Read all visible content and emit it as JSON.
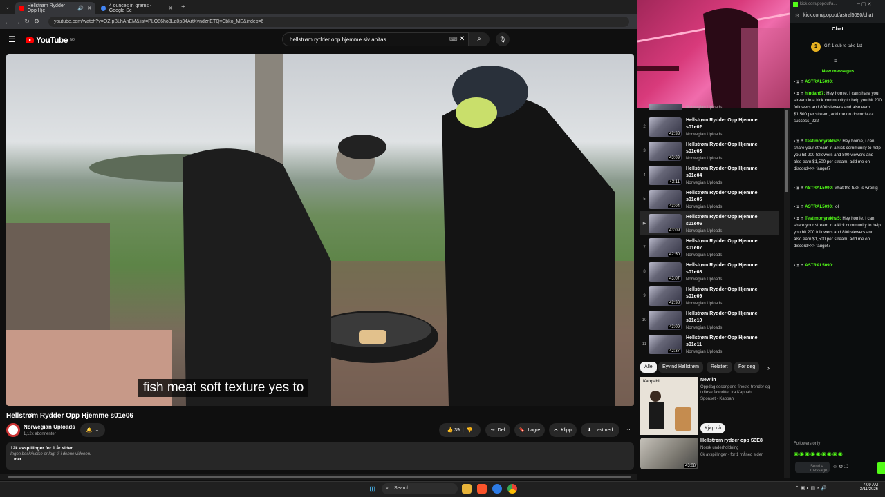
{
  "browser_tabs": [
    {
      "label": "Hellstrøm Rydder Opp Hje",
      "active": true
    },
    {
      "label": "4 ounces in grams - Google Se",
      "active": false
    }
  ],
  "url": "youtube.com/watch?v=OZIpBLhAnEM&list=PLO86ho8La0p34ArtXvndznETQvCbko_ME&index=6",
  "youtube": {
    "logo_text": "YouTube",
    "logo_region": "NO",
    "search_value": "hellstrøm rydder opp hjemme siv anitas"
  },
  "video": {
    "caption": "fish meat soft texture yes to",
    "title": "Hellstrøm Rydder Opp Hjemme s01e06",
    "channel": "Norwegian Uploads",
    "subscribers": "1,12k abonnenter"
  },
  "actions": {
    "likes": "39",
    "share": "Del",
    "save": "Lagre",
    "clip": "Klipp",
    "download": "Last ned"
  },
  "description": {
    "stats": "12k avspillinger  for 1 år siden",
    "text": "Ingen beskrivelse er lagt til i denne videoen.",
    "more": "...mer"
  },
  "playlist": [
    {
      "num": "",
      "title": "",
      "channel": "Norwegian Uploads",
      "duration": "",
      "current": false,
      "partial": true
    },
    {
      "num": "2",
      "title": "Hellstrøm Rydder Opp Hjemme s01e02",
      "channel": "Norwegian Uploads",
      "duration": "42:33",
      "current": false
    },
    {
      "num": "3",
      "title": "Hellstrøm Rydder Opp Hjemme s01e03",
      "channel": "Norwegian Uploads",
      "duration": "43:09",
      "current": false
    },
    {
      "num": "4",
      "title": "Hellstrøm Rydder Opp Hjemme s01e04",
      "channel": "Norwegian Uploads",
      "duration": "43:11",
      "current": false
    },
    {
      "num": "5",
      "title": "Hellstrøm Rydder Opp Hjemme s01e05",
      "channel": "Norwegian Uploads",
      "duration": "43:04",
      "current": false
    },
    {
      "num": "▶",
      "title": "Hellstrøm Rydder Opp Hjemme s01e06",
      "channel": "Norwegian Uploads",
      "duration": "43:09",
      "current": true
    },
    {
      "num": "7",
      "title": "Hellstrøm Rydder Opp Hjemme s01e07",
      "channel": "Norwegian Uploads",
      "duration": "42:50",
      "current": false
    },
    {
      "num": "8",
      "title": "Hellstrøm Rydder Opp Hjemme s01e08",
      "channel": "Norwegian Uploads",
      "duration": "43:07",
      "current": false
    },
    {
      "num": "9",
      "title": "Hellstrøm Rydder Opp Hjemme s01e09",
      "channel": "Norwegian Uploads",
      "duration": "42:38",
      "current": false
    },
    {
      "num": "10",
      "title": "Hellstrøm Rydder Opp Hjemme s01e10",
      "channel": "Norwegian Uploads",
      "duration": "43:09",
      "current": false
    },
    {
      "num": "11",
      "title": "Hellstrøm Rydder Opp Hjemme s01e11",
      "channel": "Norwegian Uploads",
      "duration": "42:37",
      "current": false
    }
  ],
  "chips": [
    "Alle",
    "Eyvind Hellstrøm",
    "Relatert",
    "For deg"
  ],
  "ad": {
    "title": "New in",
    "text": "Oppdag sesongens fineste trender og tidløse favoritter fra Kappahl.",
    "sponsor": "Sponset · Kappahl",
    "cta": "Kjøp nå",
    "brand": "Kappahl"
  },
  "rec": {
    "title": "Hellstrøm rydder opp S3E8",
    "channel": "Norsk underholdning",
    "stats": "6k avspillinger · for 1 måned siden",
    "duration": "43:08"
  },
  "kick": {
    "url_small": "kick.com/popout/a...",
    "url": "kick.com/popout/astral5090/chat",
    "header": "Chat",
    "gift": "Gift 1 sub to take 1st",
    "new_messages": "New messages",
    "followers_only": "Followers only",
    "placeholder": "Send a message"
  },
  "chat": [
    {
      "user": "ASTRAL5090:",
      "text": "",
      "color": "#53fc18"
    },
    {
      "user": "hindan67:",
      "text": "Hey homie, I can share your stream in a kick community to help you hit 200 followers and 800 viewers and also earn $1,500 per stream, add me on discord>>> success_222",
      "color": "#53fc18"
    },
    {
      "user": "Testimonyrekha5:",
      "text": "Hey homie, i can share your stream in a kick community to help you hit 200 followers and 800 viewers and also earn $1,500 per stream, add me on discord>>> fauget7",
      "color": "#53fc18"
    },
    {
      "user": "ASTRAL5090:",
      "text": "what the fuck is wrontg",
      "color": "#53fc18"
    },
    {
      "user": "ASTRAL5090:",
      "text": "lol",
      "color": "#53fc18"
    },
    {
      "user": "Testimonyrekha5:",
      "text": "Hey homie, i can share your stream in a kick community to help you hit 200 followers and 800 viewers and also earn $1,500 per stream, add me on discord>>> fauget7",
      "color": "#53fc18"
    },
    {
      "user": "ASTRAL5090:",
      "text": "",
      "color": "#53fc18"
    }
  ],
  "taskbar": {
    "search": "Search",
    "time": "7:09 AM",
    "date": "3/11/2026"
  },
  "colors": {
    "kick_green": "#53fc18",
    "yt_red": "#ff0000"
  }
}
